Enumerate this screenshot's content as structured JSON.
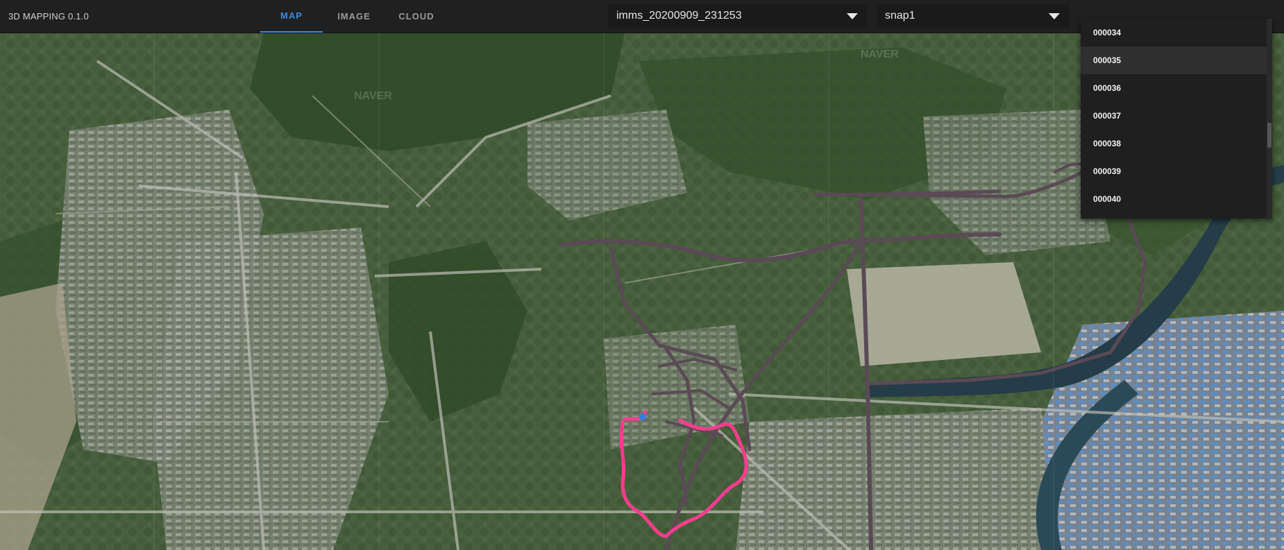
{
  "app": {
    "title": "3D MAPPING 0.1.0"
  },
  "tabs": [
    {
      "label": "MAP",
      "active": true
    },
    {
      "label": "IMAGE",
      "active": false
    },
    {
      "label": "CLOUD",
      "active": false
    }
  ],
  "selectors": {
    "dataset": {
      "value": "imms_20200909_231253"
    },
    "snapshot": {
      "value": "snap1"
    }
  },
  "dropdown": {
    "items": [
      "000034",
      "000035",
      "000036",
      "000037",
      "000038",
      "000039",
      "000040"
    ],
    "hovered": "000035"
  },
  "map": {
    "watermark": "NAVER",
    "route_color": "#ff3c8e",
    "track_color": "#5a4a55",
    "marker_color": "#2f7fe6"
  }
}
